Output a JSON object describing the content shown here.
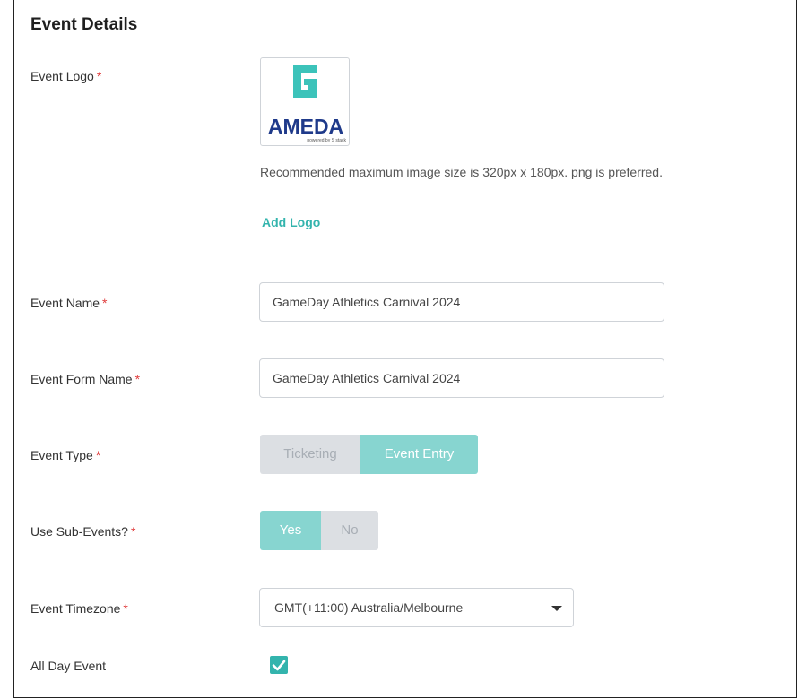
{
  "section": {
    "title": "Event Details"
  },
  "logo_field": {
    "label": "Event Logo",
    "required_mark": "*",
    "logo_text": "AMEDA",
    "logo_subtext": "powered by S stack",
    "hint": "Recommended maximum image size is 320px x 180px. png is preferred.",
    "add_label": "Add Logo"
  },
  "event_name": {
    "label": "Event Name",
    "required_mark": "*",
    "value": "GameDay Athletics Carnival 2024"
  },
  "event_form_name": {
    "label": "Event Form Name",
    "required_mark": "*",
    "value": "GameDay Athletics Carnival 2024"
  },
  "event_type": {
    "label": "Event Type",
    "required_mark": "*",
    "options": [
      "Ticketing",
      "Event Entry"
    ],
    "selected": "Event Entry"
  },
  "sub_events": {
    "label": "Use Sub-Events?",
    "required_mark": "*",
    "options": [
      "Yes",
      "No"
    ],
    "selected": "Yes"
  },
  "timezone": {
    "label": "Event Timezone",
    "required_mark": "*",
    "value": "GMT(+11:00) Australia/Melbourne"
  },
  "all_day": {
    "label": "All Day Event",
    "checked": true
  },
  "colors": {
    "accent": "#33b4ad",
    "toggle_active": "#87d5d0",
    "toggle_inactive": "#dcdfe3",
    "required": "#e03c3c",
    "logo_blue": "#1f3a8a"
  },
  "icons": {
    "dropdown": "chevron-down-icon",
    "checkbox": "check-icon",
    "logo": "gameday-g-logo"
  }
}
